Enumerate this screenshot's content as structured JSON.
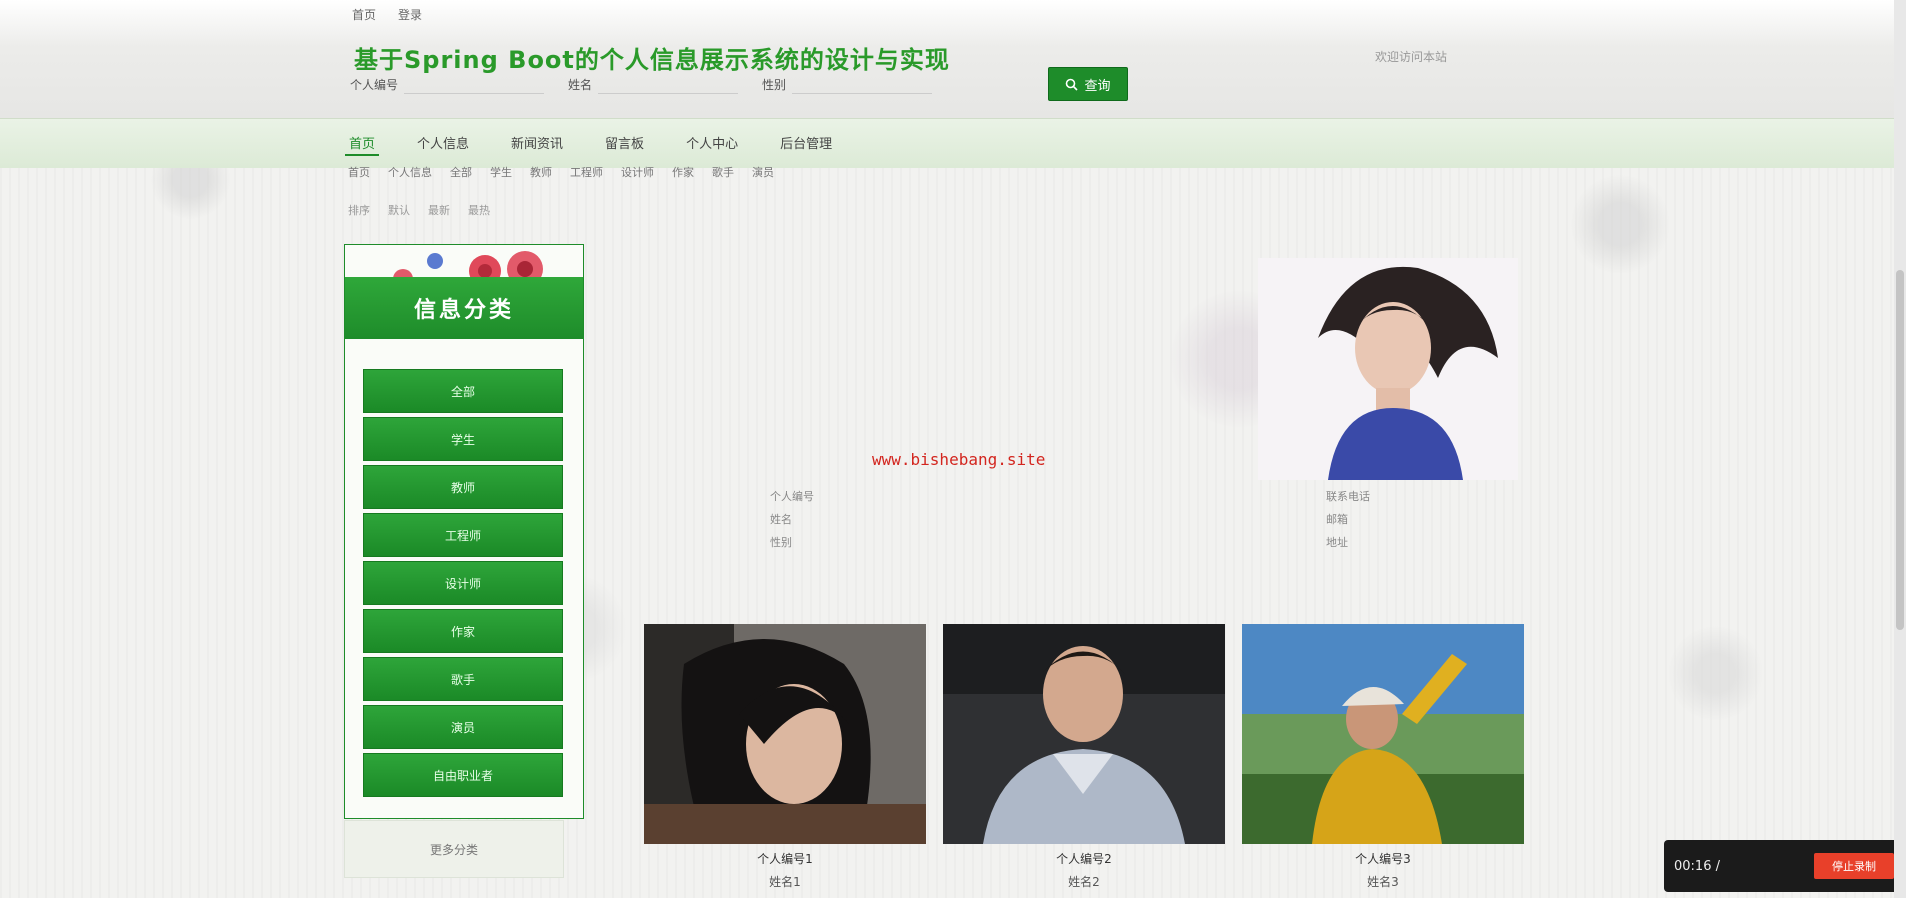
{
  "header": {
    "top_links": [
      "首页",
      "登录"
    ],
    "site_title": "基于Spring Boot的个人信息展示系统的设计与实现",
    "top_right_text": "欢迎访问本站"
  },
  "search": {
    "labels": [
      "个人编号",
      "姓名",
      "性别"
    ],
    "button_label": "查询"
  },
  "nav": {
    "items": [
      "首页",
      "个人信息",
      "新闻资讯",
      "留言板",
      "个人中心",
      "后台管理"
    ]
  },
  "breadcrumb": [
    "首页",
    "个人信息",
    "全部",
    "学生",
    "教师",
    "工程师",
    "设计师",
    "作家",
    "歌手",
    "演员"
  ],
  "breadcrumb2": [
    "排序",
    "默认",
    "最新",
    "最热"
  ],
  "sidebar": {
    "title": "信息分类",
    "categories": [
      "全部",
      "学生",
      "教师",
      "工程师",
      "设计师",
      "作家",
      "歌手",
      "演员",
      "自由职业者"
    ],
    "bottom_label": "更多分类"
  },
  "feature": {
    "watermark": "www.bishebang.site",
    "rows": [
      [
        "个人编号",
        "",
        "联系电话"
      ],
      [
        "姓名",
        "",
        "邮箱"
      ],
      [
        "性别",
        "",
        "地址"
      ]
    ]
  },
  "cards": [
    {
      "name": "个人编号1",
      "sub": "姓名1"
    },
    {
      "name": "个人编号2",
      "sub": "姓名2"
    },
    {
      "name": "个人编号3",
      "sub": "姓名3"
    }
  ],
  "player": {
    "time": "00:16 /",
    "gap": "",
    "button_label": "停止录制"
  },
  "colors": {
    "brand_green": "#1e8c2a",
    "accent_red": "#e8402a",
    "watermark_red": "#d3261f"
  }
}
